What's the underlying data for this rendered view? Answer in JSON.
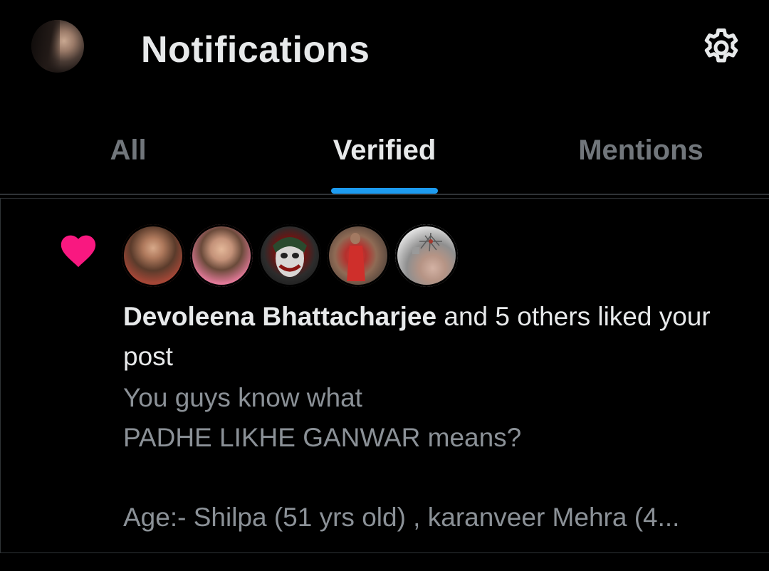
{
  "header": {
    "title": "Notifications",
    "avatar_icon": "user-avatar",
    "settings_icon": "gear-icon"
  },
  "tabs": [
    {
      "label": "All",
      "active": false
    },
    {
      "label": "Verified",
      "active": true
    },
    {
      "label": "Mentions",
      "active": false
    }
  ],
  "colors": {
    "background": "#000000",
    "text_primary": "#e7e9ea",
    "text_secondary": "#71767b",
    "accent": "#1d9bf0",
    "like": "#f91880",
    "divider": "#2f3336"
  },
  "notification": {
    "type_icon": "heart-icon",
    "actor": "Devoleena Bhattacharjee",
    "action": " and 5 others liked your post",
    "post_lines": [
      "You guys know what",
      "PADHE LIKHE GANWAR means?",
      "",
      "Age:- Shilpa (51 yrs old) , karanveer Mehra (4..."
    ]
  }
}
